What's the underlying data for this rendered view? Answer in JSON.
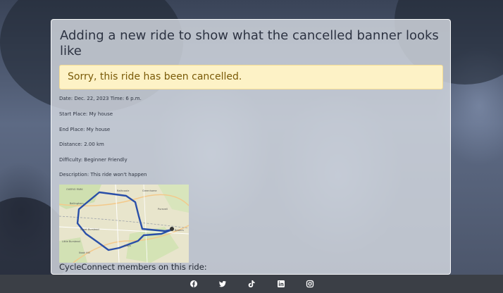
{
  "ride": {
    "title": "Adding a new ride to show what the cancelled banner looks like",
    "cancelled_banner": "Sorry, this ride has been cancelled.",
    "datetime": "Date: Dec. 22, 2023 Time: 6 p.m.",
    "start_place": "Start Place: My house",
    "end_place": "End Place: My house",
    "distance": "Distance: 2.00 km",
    "difficulty": "Difficulty: Beginner Friendly",
    "description": "Description: This ride won't happen",
    "members_heading": "CycleConnect members on this ride:"
  },
  "footer": {
    "social": [
      {
        "icon": "facebook-icon"
      },
      {
        "icon": "twitter-icon"
      },
      {
        "icon": "tiktok-icon"
      },
      {
        "icon": "linkedin-icon"
      },
      {
        "icon": "instagram-icon"
      }
    ]
  },
  "colors": {
    "banner_bg": "#fdf2c6",
    "banner_text": "#7a5a08",
    "route": "#2a4fa8",
    "footer_bg": "#3b3f46"
  }
}
